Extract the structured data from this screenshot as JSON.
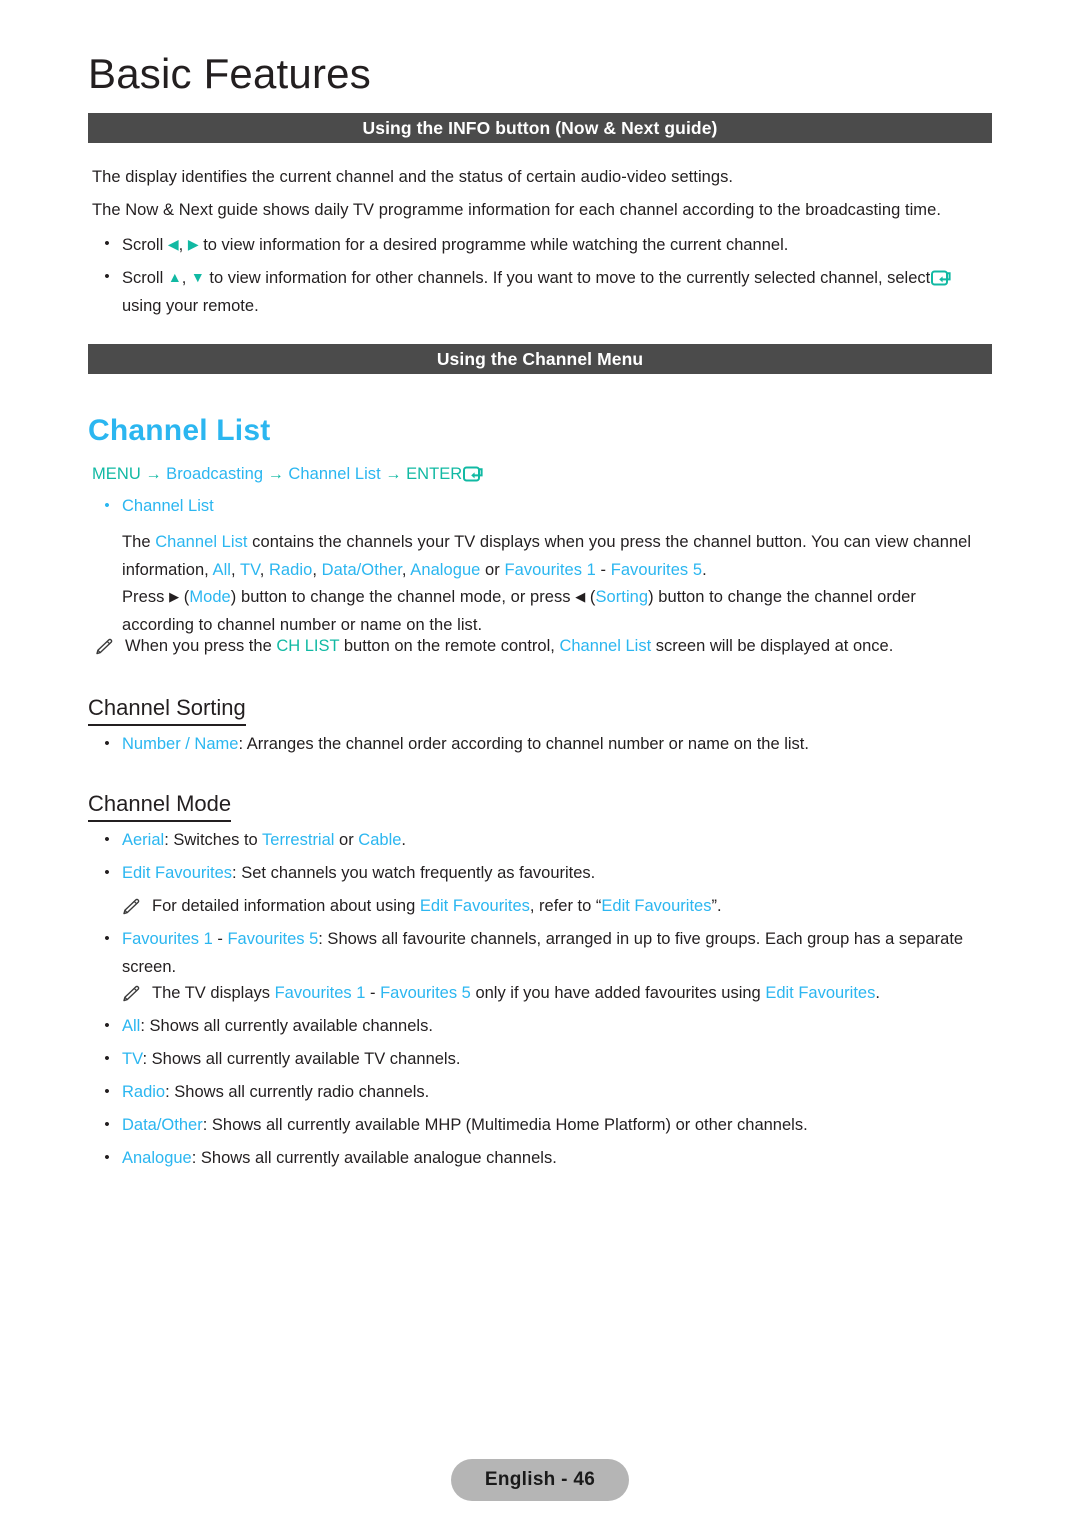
{
  "page": {
    "title": "Basic Features",
    "footer_label": "English - 46",
    "language": "English",
    "page_number": "46"
  },
  "colors": {
    "section_bar_bg": "#4b4b4b",
    "highlight_blue": "#2bb6f0",
    "highlight_teal": "#11b9a3",
    "body_text": "#231f20",
    "footer_pill_bg": "#b5b5b5"
  },
  "sections": [
    {
      "id": "info-button",
      "bar_title": "Using the INFO button (Now & Next guide)"
    },
    {
      "id": "channel-menu",
      "bar_title": "Using the Channel Menu"
    }
  ],
  "info_section": {
    "paragraph_1": "The display identifies the current channel and the status of certain audio-video settings.",
    "paragraph_2": "The Now & Next guide shows daily TV programme information for each channel according to the broadcasting time.",
    "bullets": [
      {
        "lead": "Scroll",
        "arrow_left": "◀",
        "comma": ",",
        "arrow_right": "▶",
        "tail": "to view information for a desired programme while watching the current channel."
      },
      {
        "lead": "Scroll",
        "arrow_up": "▲",
        "comma": ",",
        "arrow_down": "▼",
        "tail_1": "to view information for other channels. If you want to move to the currently selected channel, select",
        "tail_2": "using your remote."
      }
    ]
  },
  "channel_list": {
    "heading": "Channel List",
    "breadcrumb": {
      "menu": "MENU",
      "arrow": "→",
      "broadcasting": "Broadcasting",
      "channel_list": "Channel List",
      "enter": "ENTER",
      "enter_icon": "enter-icon"
    },
    "sub_bullet": "Channel List",
    "paragraph_1": {
      "p1": "The ",
      "hl1": "Channel List",
      "p2": " contains the channels your TV displays when you press the channel button. You can view channel information, ",
      "hl_all": "All",
      "sep1": ", ",
      "hl_tv": "TV",
      "sep2": ", ",
      "hl_radio": "Radio",
      "sep3": ", ",
      "hl_data": "Data/Other",
      "sep4": ", ",
      "hl_analogue": "Analogue",
      "sep5": " or ",
      "hl_fav1": "Favourites 1",
      "sep6": " - ",
      "hl_fav5": "Favourites 5",
      "sep7": "."
    },
    "paragraph_2": {
      "p1": "Press ",
      "arrow_right": "▶",
      "p2": " (",
      "hl_mode": "Mode",
      "p3": ") button to change the channel mode, or press ",
      "arrow_left": "◀",
      "p4": " (",
      "hl_sorting": "Sorting",
      "p5": ") button to change the channel order according to channel number or name on the list."
    },
    "note": {
      "p1": "When you press the ",
      "hl_chlist": "CH LIST",
      "p2": " button on the remote control, ",
      "hl_channel_list": "Channel List",
      "p3": " screen will be displayed at once."
    }
  },
  "channel_sorting": {
    "heading": "Channel Sorting",
    "bullet": {
      "hl": "Number / Name",
      "text": ": Arranges the channel order according to channel number or name on the list."
    }
  },
  "channel_mode": {
    "heading": "Channel Mode",
    "bullets": [
      {
        "id": "aerial",
        "hl": "Aerial",
        "p1": ": Switches to ",
        "hl2": "Terrestrial",
        "p2": " or ",
        "hl3": "Cable",
        "p3": "."
      },
      {
        "id": "edit-favourites",
        "hl": "Edit Favourites",
        "p1": ": Set channels you watch frequently as favourites."
      },
      {
        "id": "favourites-groups",
        "hl": "Favourites 1",
        "sep": " - ",
        "hl2": "Favourites 5",
        "p1": ": Shows all favourite channels, arranged in up to five groups. Each group has a separate screen."
      },
      {
        "id": "all",
        "hl": "All",
        "p1": ": Shows all currently available channels."
      },
      {
        "id": "tv",
        "hl": "TV",
        "p1": ": Shows all currently available TV channels."
      },
      {
        "id": "radio",
        "hl": "Radio",
        "p1": ": Shows all currently radio channels."
      },
      {
        "id": "data-other",
        "hl": "Data/Other",
        "p1": ": Shows all currently available MHP (Multimedia Home Platform) or other channels."
      },
      {
        "id": "analogue",
        "hl": "Analogue",
        "p1": ": Shows all currently available analogue channels."
      }
    ],
    "note_edit_favourites": {
      "p1": "For detailed information about using ",
      "hl1": "Edit Favourites",
      "p2": ", refer to “",
      "hl2": "Edit Favourites",
      "p3": "”."
    },
    "note_favourites": {
      "p1": "The TV displays ",
      "hl1": "Favourites 1",
      "sep": " - ",
      "hl2": "Favourites 5",
      "p2": " only if you have added favourites using ",
      "hl3": "Edit Favourites",
      "p3": "."
    }
  }
}
